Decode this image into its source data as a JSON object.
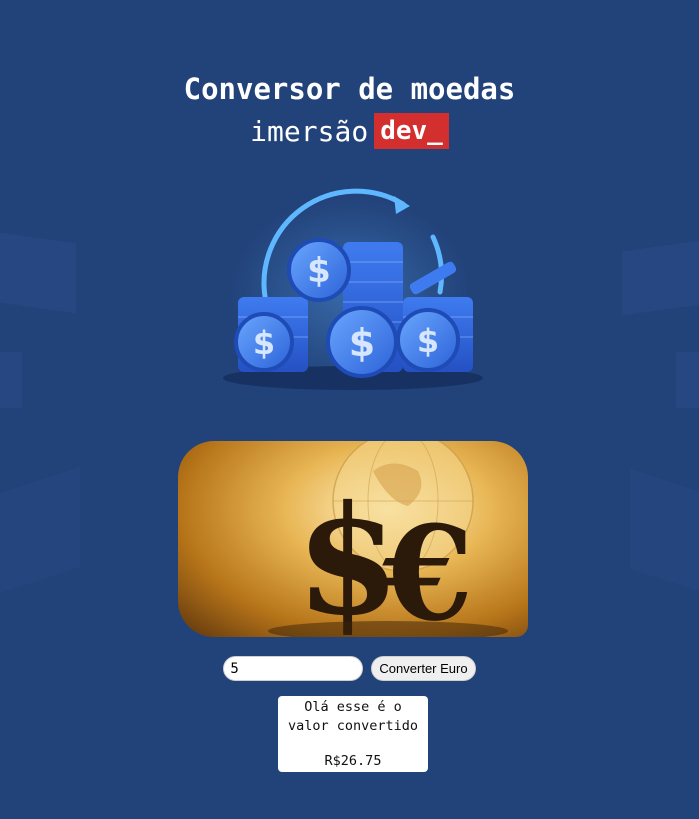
{
  "header": {
    "title": "Conversor de moedas",
    "brand_text": "imersão",
    "brand_tag": "dev_"
  },
  "hero": {
    "icon": "coins-exchange-icon"
  },
  "photo": {
    "icon": "dollar-euro-globe-image"
  },
  "form": {
    "amount_value": "5",
    "convert_label": "Converter Euro"
  },
  "result": {
    "line1": "Olá esse é o",
    "line2": "valor convertido",
    "value": "R$26.75"
  },
  "colors": {
    "background": "#22427a",
    "brand_tag": "#d32f2f",
    "coin_blue": "#2f6fe8"
  }
}
